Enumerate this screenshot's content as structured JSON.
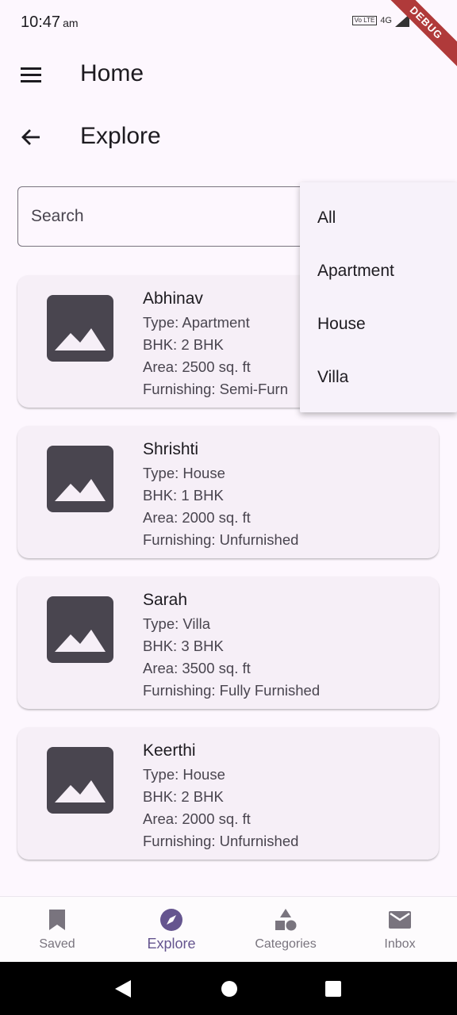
{
  "status_bar": {
    "time": "10:47",
    "ampm": "am",
    "network": "4G",
    "volte": "Vo LTE",
    "debug_label": "DEBUG"
  },
  "top_bar": {
    "title": "Home",
    "menu_icon": "menu-icon"
  },
  "sub_bar": {
    "title": "Explore",
    "back_icon": "arrow-back-icon"
  },
  "search": {
    "placeholder": "Search",
    "value": ""
  },
  "filter_dropdown": {
    "options": [
      "All",
      "Apartment",
      "House",
      "Villa"
    ]
  },
  "listings": [
    {
      "name": "Abhinav",
      "type": "Type: Apartment",
      "bhk": "BHK: 2 BHK",
      "area": "Area: 2500 sq. ft",
      "furnishing": "Furnishing: Semi-Furn"
    },
    {
      "name": "Shrishti",
      "type": "Type: House",
      "bhk": "BHK: 1 BHK",
      "area": "Area: 2000 sq. ft",
      "furnishing": "Furnishing: Unfurnished"
    },
    {
      "name": "Sarah",
      "type": "Type: Villa",
      "bhk": "BHK: 3 BHK",
      "area": "Area: 3500 sq. ft",
      "furnishing": "Furnishing: Fully Furnished"
    },
    {
      "name": "Keerthi",
      "type": "Type: House",
      "bhk": "BHK: 2 BHK",
      "area": "Area: 2000 sq. ft",
      "furnishing": "Furnishing: Unfurnished"
    }
  ],
  "bottom_nav": [
    {
      "label": "Saved",
      "icon": "bookmark-icon"
    },
    {
      "label": "Explore",
      "icon": "compass-icon",
      "active": true
    },
    {
      "label": "Categories",
      "icon": "categories-icon"
    },
    {
      "label": "Inbox",
      "icon": "mail-icon"
    }
  ],
  "colors": {
    "background": "#fdf7fe",
    "card": "#f6eff7",
    "accent": "#65558f",
    "thumbnail": "#49454f",
    "debug": "#b03a3a"
  }
}
